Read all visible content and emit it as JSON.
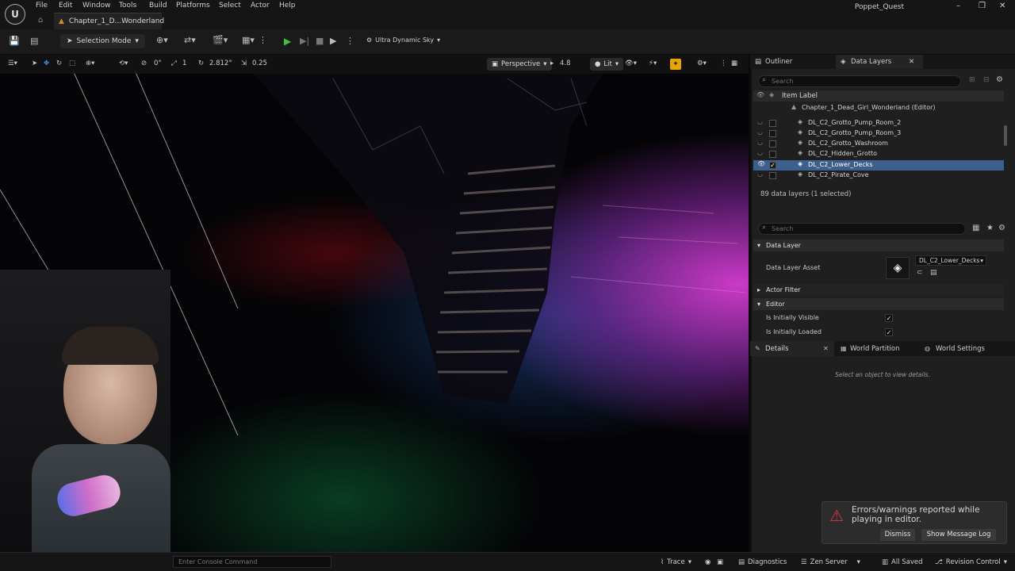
{
  "menubar": {
    "items": [
      "File",
      "Edit",
      "Window",
      "Tools",
      "Build",
      "Platforms",
      "Select",
      "Actor",
      "Help"
    ],
    "project_name": "Poppet_Quest"
  },
  "tabs": {
    "level_tab": "Chapter_1_D...Wonderland"
  },
  "toolbar": {
    "selection_mode": "Selection Mode",
    "sky_preset": "Ultra Dynamic Sky"
  },
  "viewport_toolbar": {
    "grid_angle": "0°",
    "grid_snap": "1",
    "rotation_snap": "2.812°",
    "scale_snap": "0.25",
    "view_mode": "Perspective",
    "fov": "4.8",
    "lighting": "Lit"
  },
  "outliner": {
    "tabs": [
      "Outliner",
      "Data Layers"
    ],
    "search_placeholder": "Search",
    "header": "Item Label",
    "root": "Chapter_1_Dead_Girl_Wonderland (Editor)",
    "rows": [
      {
        "label": "DL_C2_Grotto_Pump_Room_2",
        "selected": false,
        "checked": false
      },
      {
        "label": "DL_C2_Grotto_Pump_Room_3",
        "selected": false,
        "checked": false
      },
      {
        "label": "DL_C2_Grotto_Washroom",
        "selected": false,
        "checked": false
      },
      {
        "label": "DL_C2_Hidden_Grotto",
        "selected": false,
        "checked": false
      },
      {
        "label": "DL_C2_Lower_Decks",
        "selected": true,
        "checked": true
      },
      {
        "label": "DL_C2_Pirate_Cove",
        "selected": false,
        "checked": false
      }
    ],
    "count": "89 data layers (1 selected)"
  },
  "layer_details": {
    "search_placeholder": "Search",
    "section_data_layer": "Data Layer",
    "asset_label": "Data Layer Asset",
    "asset_value": "DL_C2_Lower_Decks",
    "section_actor_filter": "Actor Filter",
    "section_editor": "Editor",
    "is_initially_visible": "Is Initially Visible",
    "is_initially_loaded": "Is Initially Loaded"
  },
  "details": {
    "tabs": [
      "Details",
      "World Partition",
      "World Settings"
    ],
    "empty_message": "Select an object to view details."
  },
  "statusbar": {
    "console_placeholder": "Enter Console Command",
    "trace": "Trace",
    "diagnostics": "Diagnostics",
    "zen_server": "Zen Server",
    "all_saved": "All Saved",
    "revision_control": "Revision Control"
  },
  "toast": {
    "message": "Errors/warnings reported while playing in editor.",
    "dismiss": "Dismiss",
    "show_log": "Show Message Log"
  }
}
